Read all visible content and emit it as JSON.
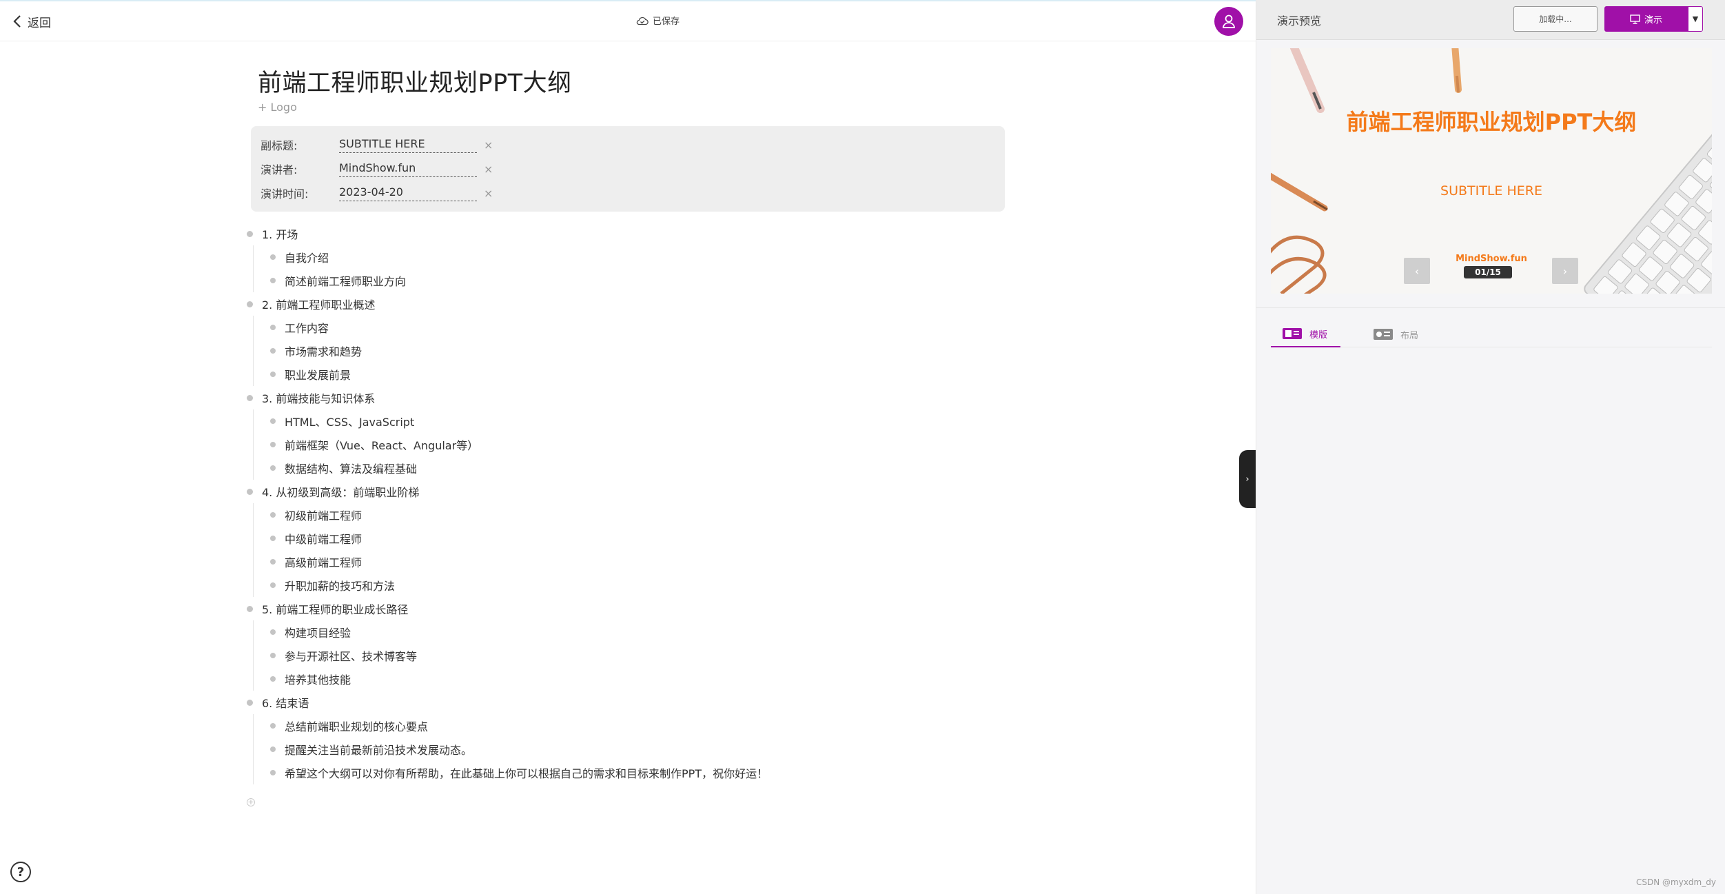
{
  "topbar": {
    "back_label": "返回",
    "save_status": "已保存"
  },
  "document": {
    "title": "前端工程师职业规划PPT大纲",
    "logo_add": "+ Logo",
    "meta": [
      {
        "label": "副标题:",
        "value": "SUBTITLE HERE"
      },
      {
        "label": "演讲者:",
        "value": "MindShow.fun"
      },
      {
        "label": "演讲时间:",
        "value": "2023-04-20"
      }
    ],
    "meta_clear_glyph": "×"
  },
  "outline": [
    {
      "text": "1. 开场",
      "children": [
        "自我介绍",
        "简述前端工程师职业方向"
      ]
    },
    {
      "text": "2. 前端工程师职业概述",
      "children": [
        "工作内容",
        "市场需求和趋势",
        "职业发展前景"
      ]
    },
    {
      "text": "3. 前端技能与知识体系",
      "children": [
        "HTML、CSS、JavaScript",
        "前端框架（Vue、React、Angular等）",
        "数据结构、算法及编程基础"
      ]
    },
    {
      "text": "4. 从初级到高级：前端职业阶梯",
      "children": [
        "初级前端工程师",
        "中级前端工程师",
        "高级前端工程师",
        "升职加薪的技巧和方法"
      ]
    },
    {
      "text": "5. 前端工程师的职业成长路径",
      "children": [
        "构建项目经验",
        "参与开源社区、技术博客等",
        "培养其他技能"
      ]
    },
    {
      "text": "6. 结束语",
      "children": [
        "总结前端职业规划的核心要点",
        "提醒关注当前最新前沿技术发展动态。",
        "希望这个大纲可以对你有所帮助，在此基础上你可以根据自己的需求和目标来制作PPT，祝你好运！"
      ]
    }
  ],
  "add_row_glyph": "+",
  "help_glyph": "?",
  "collapse_glyph": "›",
  "panel": {
    "title": "演示预览",
    "loading_label": "加载中...",
    "present_label": "演示",
    "dropdown_glyph": "▼",
    "slide": {
      "title": "前端工程师职业规划PPT大纲",
      "subtitle": "SUBTITLE HERE",
      "author": "MindShow.fun",
      "counter": "01/15",
      "prev_glyph": "‹",
      "next_glyph": "›"
    },
    "tabs": [
      {
        "label": "模版",
        "icon": "template-icon",
        "active": true
      },
      {
        "label": "布局",
        "icon": "layout-icon",
        "active": false
      }
    ]
  },
  "watermark": "CSDN @myxdm_dy",
  "colors": {
    "accent": "#a010a8",
    "slide_accent": "#f47a1a"
  },
  "icons": [
    "chevron-left-icon",
    "cloud-check-icon",
    "user-icon",
    "presentation-icon",
    "help-icon"
  ]
}
